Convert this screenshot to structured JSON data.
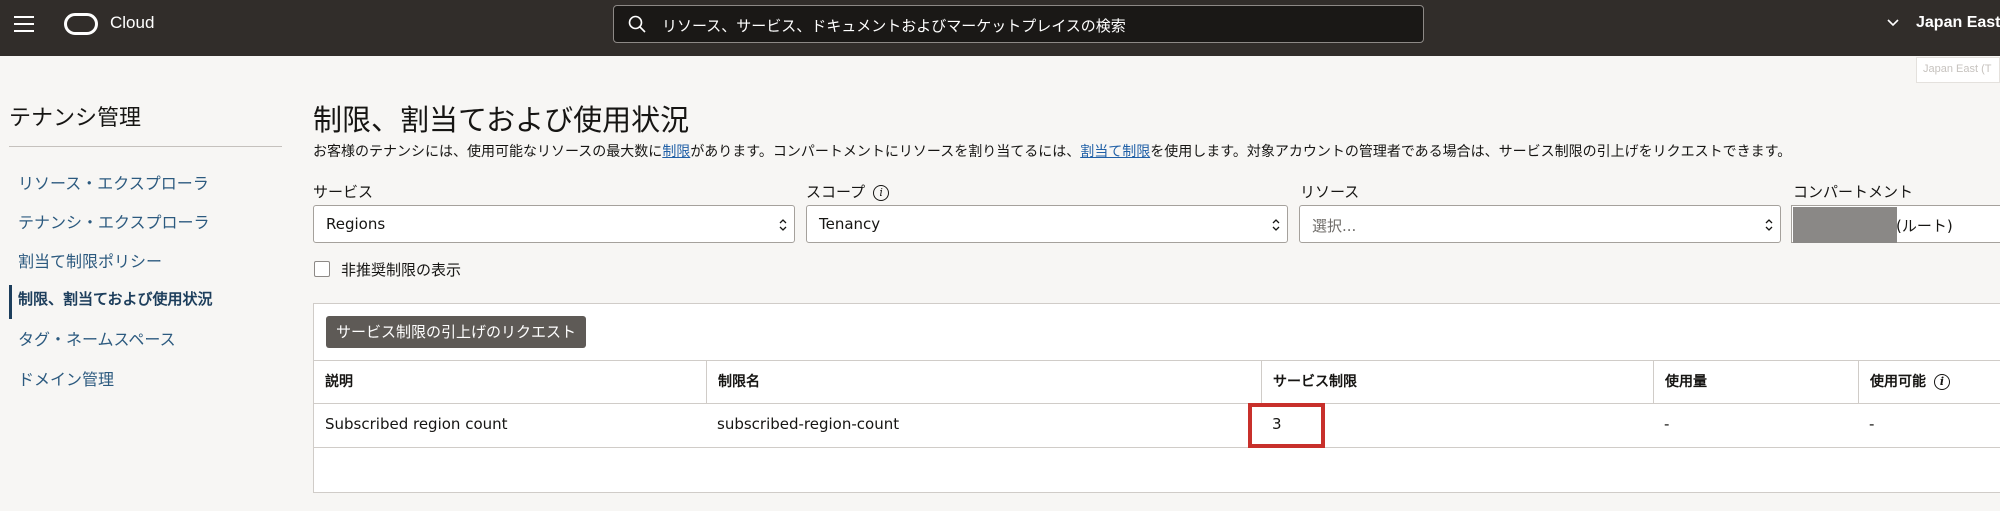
{
  "topbar": {
    "brand": "Cloud",
    "search_placeholder": "リソース、サービス、ドキュメントおよびマーケットプレイスの検索",
    "region": "Japan East",
    "region_tooltip": "Japan East (T"
  },
  "sidebar": {
    "title": "テナンシ管理",
    "items": [
      {
        "label": "リソース・エクスプローラ"
      },
      {
        "label": "テナンシ・エクスプローラ"
      },
      {
        "label": "割当て制限ポリシー"
      },
      {
        "label": "制限、割当ておよび使用状況",
        "active": true
      },
      {
        "label": "タグ・ネームスペース"
      },
      {
        "label": "ドメイン管理"
      }
    ]
  },
  "main": {
    "title": "制限、割当ておよび使用状況",
    "description": {
      "p1": "お客様のテナンシには、使用可能なリソースの最大数に",
      "link1": "制限",
      "p2": "があります。コンパートメントにリソースを割り当てるには、",
      "link2": "割当て制限",
      "p3": "を使用します。対象アカウントの管理者である場合は、サービス制限の引上げをリクエストできます。"
    },
    "filters": {
      "service": {
        "label": "サービス",
        "value": "Regions"
      },
      "scope": {
        "label": "スコープ",
        "value": "Tenancy"
      },
      "resource": {
        "label": "リソース",
        "value": "選択..."
      },
      "compartment": {
        "label": "コンパートメント",
        "value": "(ルート)"
      }
    },
    "deprecated_checkbox_label": "非推奨制限の表示",
    "request_button": "サービス制限の引上げのリクエスト",
    "table": {
      "columns": [
        "説明",
        "制限名",
        "サービス制限",
        "使用量",
        "使用可能"
      ],
      "rows": [
        [
          "Subscribed region count",
          "subscribed-region-count",
          "3",
          "-",
          "-"
        ]
      ]
    },
    "highlight_color": "#c8302b"
  }
}
